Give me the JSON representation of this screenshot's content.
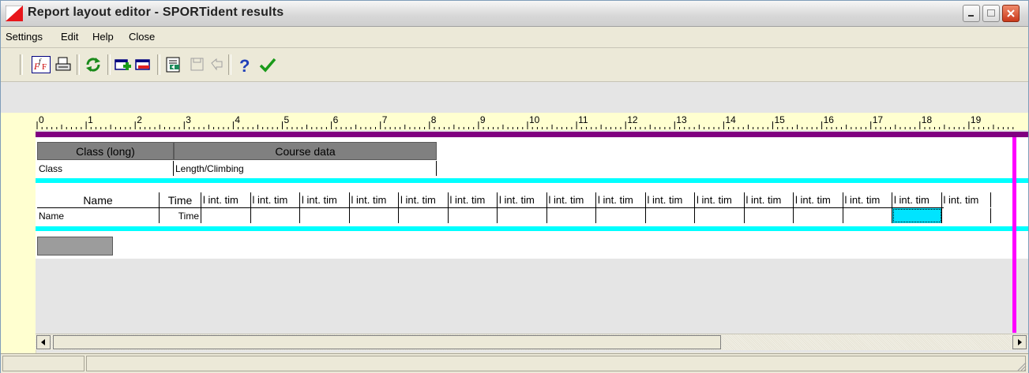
{
  "window": {
    "title": "Report layout editor - SPORTident results"
  },
  "menu": {
    "settings": "Settings",
    "edit": "Edit",
    "help": "Help",
    "close": "Close"
  },
  "toolbar": {
    "icons": [
      "font-icon",
      "print-icon",
      "refresh-icon",
      "add-band-icon",
      "remove-band-icon",
      "properties-icon",
      "disabled-save-icon",
      "disabled-undo-icon",
      "help-icon",
      "confirm-icon"
    ]
  },
  "ruler": {
    "numbers": [
      "0",
      "1",
      "2",
      "3",
      "4",
      "5",
      "6",
      "7",
      "8",
      "9",
      "10",
      "11",
      "12",
      "13",
      "14",
      "15",
      "16",
      "17",
      "18",
      "19"
    ]
  },
  "band1": {
    "headers": [
      "Class (long)",
      "Course data"
    ],
    "fields": [
      "Class",
      "Length/Climbing"
    ]
  },
  "band2": {
    "headers": [
      "Name",
      "Time",
      "l int. tim",
      "l int. tim",
      "l int. tim",
      "l int. tim",
      "l int. tim",
      "l int. tim",
      "l int. tim",
      "l int. tim",
      "l int. tim",
      "l int. tim",
      "l int. tim",
      "l int. tim",
      "l int. tim",
      "l int. tim",
      "l int. tim",
      "l int. tim"
    ],
    "fields": [
      "Name",
      "Time"
    ]
  },
  "colors": {
    "purple_band": "#800080",
    "cyan_band": "#00ffff",
    "magenta_margin": "#ff00ff",
    "ruler_bg": "#ffffd0"
  }
}
